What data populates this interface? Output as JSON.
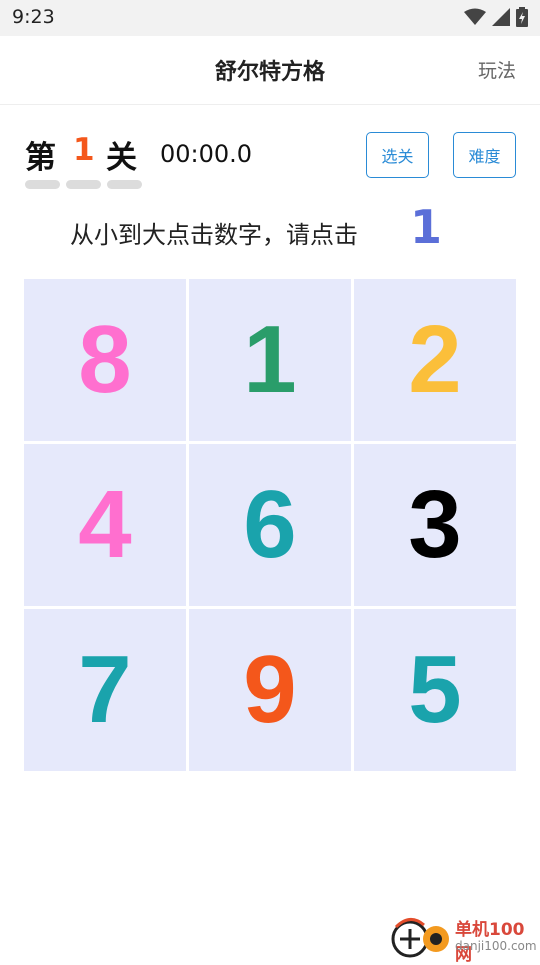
{
  "status_bar": {
    "time": "9:23"
  },
  "app_bar": {
    "title": "舒尔特方格",
    "rules_label": "玩法"
  },
  "level": {
    "prefix": "第",
    "number": "1",
    "suffix": "关",
    "timer": "00:00.0"
  },
  "buttons": {
    "select_level": "选关",
    "difficulty": "难度"
  },
  "instruction": {
    "text": "从小到大点击数字，请点击",
    "target": "1"
  },
  "grid": [
    {
      "value": "8",
      "color": "#ff6fcf"
    },
    {
      "value": "1",
      "color": "#2a9d6a"
    },
    {
      "value": "2",
      "color": "#fbbf3a"
    },
    {
      "value": "4",
      "color": "#ff6fcf"
    },
    {
      "value": "6",
      "color": "#1aa3ac"
    },
    {
      "value": "3",
      "color": "#000000"
    },
    {
      "value": "7",
      "color": "#1aa3ac"
    },
    {
      "value": "9",
      "color": "#f4571b"
    },
    {
      "value": "5",
      "color": "#1aa3ac"
    }
  ],
  "watermark": {
    "name": "单机100网",
    "domain": "danji100.com"
  }
}
